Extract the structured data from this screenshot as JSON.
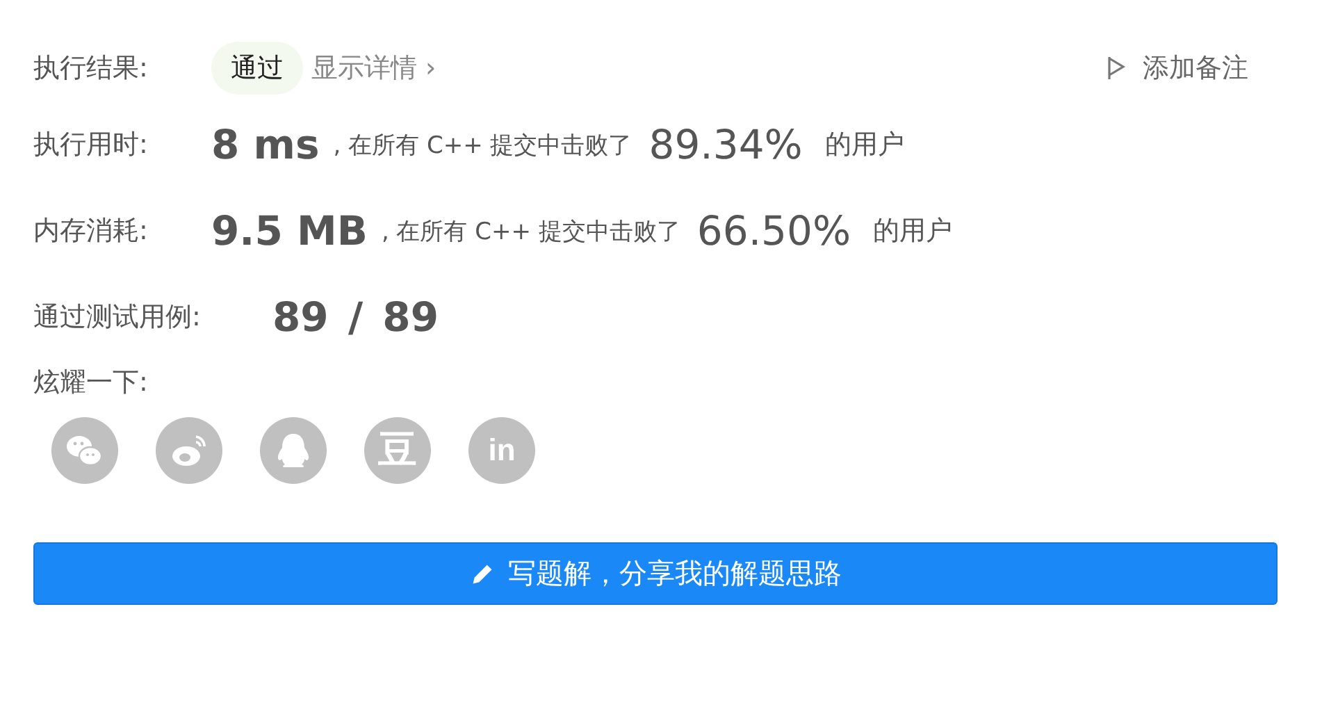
{
  "result": {
    "label": "执行结果:",
    "status": "通过",
    "details_link": "显示详情",
    "details_chevron": "›",
    "note_button": "添加备注"
  },
  "stats": [
    {
      "label": "执行用时:",
      "value": "8 ms",
      "text": ", 在所有 C++ 提交中击败了",
      "percent": "89.34%",
      "suffix": "的用户"
    },
    {
      "label": "内存消耗:",
      "value": "9.5 MB",
      "text": ", 在所有 C++ 提交中击败了",
      "percent": "66.50%",
      "suffix": "的用户"
    }
  ],
  "tests": {
    "label": "通过测试用例:",
    "value": "89 / 89"
  },
  "share": {
    "label": "炫耀一下:",
    "buttons": [
      {
        "kind": "wechat"
      },
      {
        "kind": "weibo"
      },
      {
        "kind": "qq"
      },
      {
        "kind": "douban",
        "glyph": "豆"
      },
      {
        "kind": "linkedin",
        "glyph": "in"
      }
    ]
  },
  "write_button": "写题解，分享我的解题思路"
}
